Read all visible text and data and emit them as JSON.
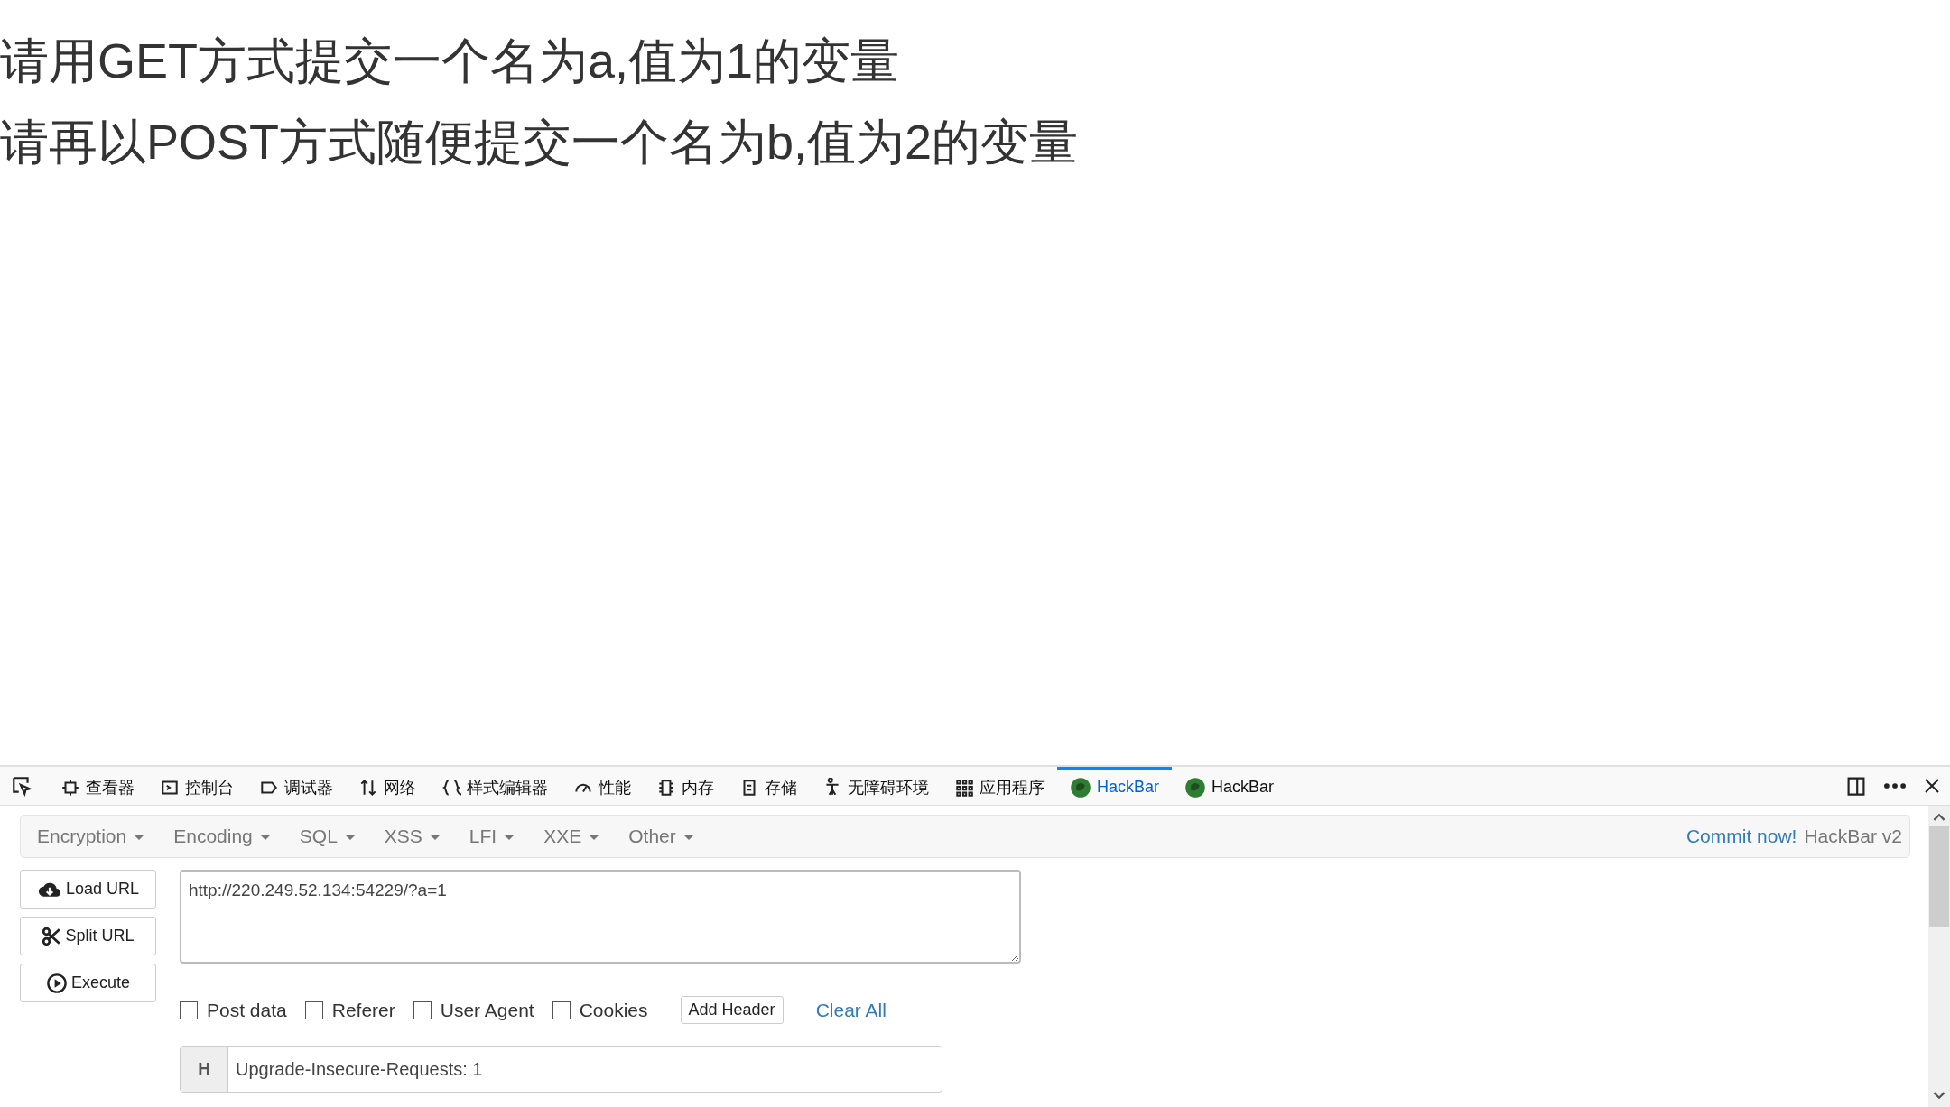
{
  "page": {
    "lines": [
      "请用GET方式提交一个名为a,值为1的变量",
      "请再以POST方式随便提交一个名为b,值为2的变量"
    ]
  },
  "devtools": {
    "tabs": [
      {
        "label": "查看器",
        "selected": false
      },
      {
        "label": "控制台",
        "selected": false
      },
      {
        "label": "调试器",
        "selected": false
      },
      {
        "label": "网络",
        "selected": false
      },
      {
        "label": "样式编辑器",
        "selected": false
      },
      {
        "label": "性能",
        "selected": false
      },
      {
        "label": "内存",
        "selected": false
      },
      {
        "label": "存储",
        "selected": false
      },
      {
        "label": "无障碍环境",
        "selected": false
      },
      {
        "label": "应用程序",
        "selected": false
      },
      {
        "label": "HackBar",
        "selected": true
      },
      {
        "label": "HackBar",
        "selected": false
      }
    ]
  },
  "hackbar": {
    "menus": [
      "Encryption",
      "Encoding",
      "SQL",
      "XSS",
      "LFI",
      "XXE",
      "Other"
    ],
    "commit_link": "Commit now!",
    "brand": "HackBar v2",
    "buttons": [
      "Load URL",
      "Split URL",
      "Execute"
    ],
    "url": "http://220.249.52.134:54229/?a=1",
    "options": [
      {
        "label": "Post data",
        "checked": false
      },
      {
        "label": "Referer",
        "checked": false
      },
      {
        "label": "User Agent",
        "checked": false
      },
      {
        "label": "Cookies",
        "checked": false
      }
    ],
    "add_header": "Add Header",
    "clear_all": "Clear All",
    "headers": [
      {
        "key": "H",
        "value": "Upgrade-Insecure-Requests: 1"
      }
    ]
  }
}
